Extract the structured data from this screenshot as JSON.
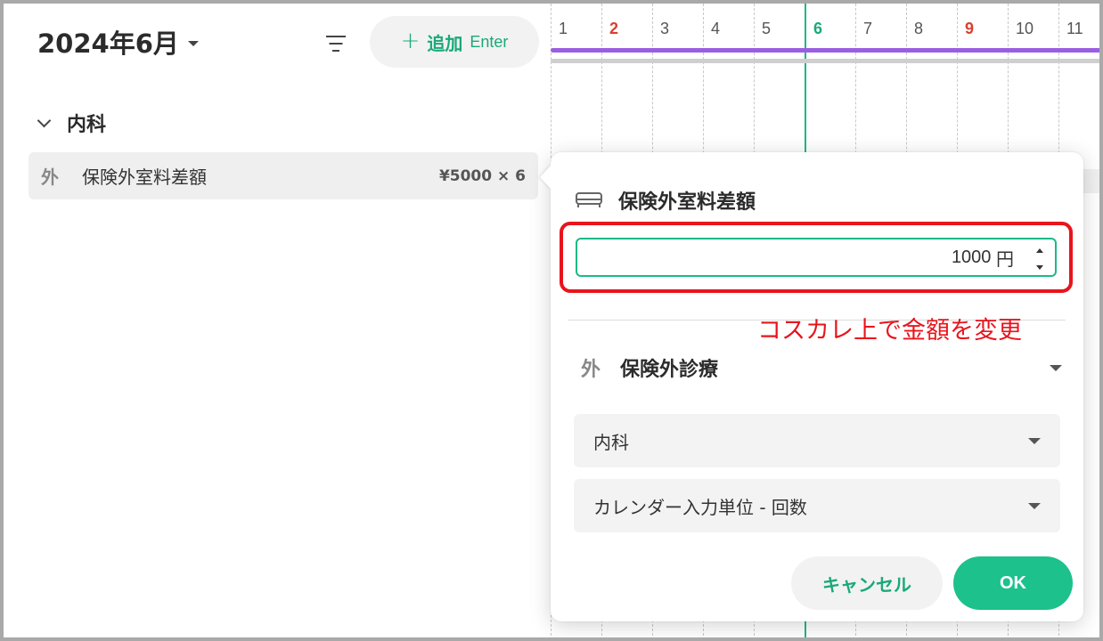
{
  "header": {
    "month": "2024年6月",
    "add_label": "追加",
    "add_hint": "Enter",
    "add_plus": "+"
  },
  "section": {
    "label": "内科"
  },
  "item_row": {
    "tag": "外",
    "name": "保険外室料差額",
    "price": "¥5000 × 6"
  },
  "timeline": {
    "days": [
      {
        "label": "1",
        "kind": "normal"
      },
      {
        "label": "2",
        "kind": "holiday"
      },
      {
        "label": "3",
        "kind": "normal"
      },
      {
        "label": "4",
        "kind": "normal"
      },
      {
        "label": "5",
        "kind": "normal"
      },
      {
        "label": "6",
        "kind": "today"
      },
      {
        "label": "7",
        "kind": "normal"
      },
      {
        "label": "8",
        "kind": "normal"
      },
      {
        "label": "9",
        "kind": "holiday"
      },
      {
        "label": "10",
        "kind": "normal"
      },
      {
        "label": "11",
        "kind": "normal"
      }
    ],
    "colors": {
      "today": "#1cb986",
      "holiday": "#d8402e",
      "range_bar": "#9a5fe0"
    }
  },
  "popover": {
    "title": "保険外室料差額",
    "title_icon": "bed-icon",
    "amount_value": "1000",
    "amount_unit": "円",
    "annotation": "コスカレ上で金額を変更",
    "insurance_tag": "外",
    "insurance_label": "保険外診療",
    "department_select": "内科",
    "unit_select": "カレンダー入力単位 - 回数",
    "cancel_label": "キャンセル",
    "ok_label": "OK"
  },
  "colors": {
    "accent": "#1cc18b",
    "highlight_box": "#e8141c"
  }
}
